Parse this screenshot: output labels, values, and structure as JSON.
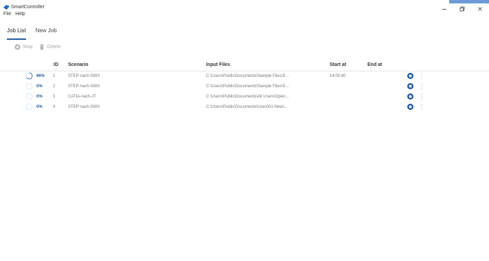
{
  "colors": {
    "accent": "#1e5aa8",
    "progress_ring": "#2a6fd6",
    "track": "#cfe0f7",
    "strip": "#6d9bd6"
  },
  "app": {
    "title": "SmartController"
  },
  "menu": {
    "items": [
      "File",
      "Help"
    ]
  },
  "tabs": [
    {
      "label": "Job List",
      "active": true
    },
    {
      "label": "New Job",
      "active": false
    }
  ],
  "toolbar": {
    "stop_label": "Stop",
    "delete_label": "Delete"
  },
  "table": {
    "columns": {
      "id": "ID",
      "scenario": "Scenario",
      "input_files": "Input Files",
      "start_at": "Start at",
      "end_at": "End at"
    },
    "rows": [
      {
        "progress": "66%",
        "progress_fraction": 0.66,
        "id": "1",
        "scenario": "STEP-nach-SWX",
        "input_files": "C:\\Users\\Public\\Documents\\Sample Files\\S...",
        "start_at": "14:00:40",
        "end_at": ""
      },
      {
        "progress": "0%",
        "progress_fraction": 0,
        "id": "2",
        "scenario": "STEP-nach-SWX",
        "input_files": "C:\\Users\\Public\\Documents\\Sample Files\\S...",
        "start_at": "",
        "end_at": ""
      },
      {
        "progress": "0%",
        "progress_fraction": 0,
        "id": "3",
        "scenario": "CATIA-nach-JT",
        "input_files": "C:\\Users\\Public\\Documents\\All Users\\Open...",
        "start_at": "",
        "end_at": ""
      },
      {
        "progress": "0%",
        "progress_fraction": 0,
        "id": "4",
        "scenario": "STEP-nach-SWX",
        "input_files": "C:\\Users\\Public\\Documents\\User001-New\\...",
        "start_at": "",
        "end_at": ""
      }
    ]
  }
}
